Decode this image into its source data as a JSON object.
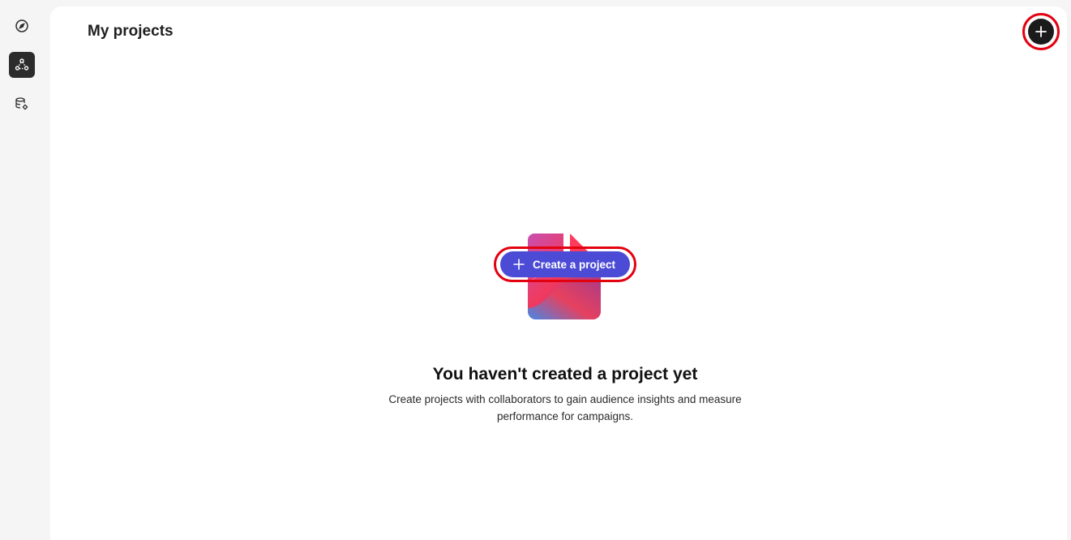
{
  "sidebar": {
    "items": [
      {
        "icon": "compass-icon",
        "active": false
      },
      {
        "icon": "collaboration-nodes-icon",
        "active": true
      },
      {
        "icon": "database-settings-icon",
        "active": false
      }
    ]
  },
  "header": {
    "title": "My projects",
    "add_icon": "plus-icon"
  },
  "empty_state": {
    "illustration": "document-icon",
    "title": "You haven't created a project yet",
    "description": "Create projects with collaborators to gain audience insights and measure performance for campaigns.",
    "cta_label": "Create a project",
    "cta_icon": "plus-icon"
  },
  "colors": {
    "cta_background": "#4b4bd6",
    "add_button_background": "#1b1b1b",
    "highlight_ring": "#e3000f",
    "active_rail_item": "#2c2c2c"
  }
}
